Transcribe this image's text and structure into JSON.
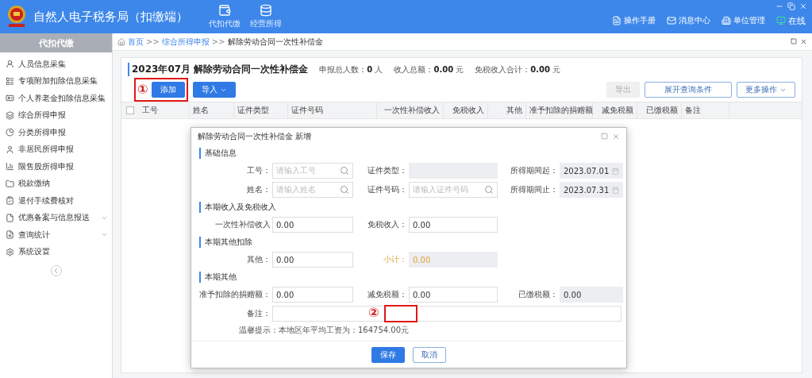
{
  "app": {
    "title": "自然人电子税务局（扣缴端）"
  },
  "modules": [
    {
      "label": "代扣代缴",
      "kind": "wallet"
    },
    {
      "label": "经营所得",
      "kind": "database"
    }
  ],
  "header_links": [
    {
      "label": "操作手册",
      "kind": "manual"
    },
    {
      "label": "消息中心",
      "kind": "mail"
    },
    {
      "label": "单位管理",
      "kind": "building"
    },
    {
      "label": "在线",
      "kind": "online"
    }
  ],
  "sidebar": {
    "title": "代扣代缴",
    "items": [
      {
        "label": "人员信息采集",
        "kind": "person",
        "expandable": false
      },
      {
        "label": "专项附加扣除信息采集",
        "kind": "list",
        "expandable": false
      },
      {
        "label": "个人养老金扣除信息采集",
        "kind": "card",
        "expandable": false
      },
      {
        "label": "综合所得申报",
        "kind": "layers",
        "expandable": false
      },
      {
        "label": "分类所得申报",
        "kind": "pie",
        "expandable": false
      },
      {
        "label": "非居民所得申报",
        "kind": "user",
        "expandable": false
      },
      {
        "label": "限售股所得申报",
        "kind": "bars",
        "expandable": false
      },
      {
        "label": "税款缴纳",
        "kind": "folder",
        "expandable": false
      },
      {
        "label": "退付手续费核对",
        "kind": "check",
        "expandable": false
      },
      {
        "label": "优惠备案与信息报送",
        "kind": "file",
        "expandable": true
      },
      {
        "label": "查询统计",
        "kind": "search",
        "expandable": true
      },
      {
        "label": "系统设置",
        "kind": "settings",
        "expandable": false
      }
    ]
  },
  "breadcrumb": {
    "separator": ">>",
    "items": [
      "首页",
      "综合所得申报",
      "解除劳动合同一次性补偿金"
    ]
  },
  "page": {
    "title": "2023年07月 解除劳动合同一次性补偿金",
    "summary": [
      {
        "label": "申报总人数：",
        "value": "0",
        "unit": "人"
      },
      {
        "label": "收入总额：",
        "value": "0.00",
        "unit": "元"
      },
      {
        "label": "免税收入合计：",
        "value": "0.00",
        "unit": "元"
      }
    ],
    "left_buttons": [
      {
        "label": "添加",
        "kind": "primary",
        "marker": "①"
      },
      {
        "label": "导入",
        "kind": "primary_dropdown"
      }
    ],
    "right_buttons": [
      {
        "label": "导出",
        "kind": "plain",
        "disabled": true
      },
      {
        "label": "展开查询条件",
        "kind": "outline",
        "disabled": false
      },
      {
        "label": "更多操作",
        "kind": "dropdown",
        "disabled": false
      }
    ]
  },
  "table": {
    "select_all_checked": false,
    "columns": [
      "工号",
      "姓名",
      "证件类型",
      "证件号码",
      "一次性补偿收入",
      "免税收入",
      "其他",
      "准予扣除的捐赠额",
      "减免税额",
      "已缴税额",
      "备注"
    ]
  },
  "dialog": {
    "title": "解除劳动合同一次性补偿金 新增",
    "sections": [
      {
        "title": "基础信息",
        "rows": [
          [
            {
              "label": "工号：",
              "placeholder": "请输入工号",
              "kind": "search"
            },
            {
              "label": "证件类型：",
              "kind": "readonly"
            },
            {
              "label": "所得期间起：",
              "value": "2023.07.01",
              "kind": "date"
            }
          ],
          [
            {
              "label": "姓名：",
              "placeholder": "请输入姓名",
              "kind": "search"
            },
            {
              "label": "证件号码：",
              "placeholder": "请输入证件号码",
              "kind": "search"
            },
            {
              "label": "所得期间止：",
              "value": "2023.07.31",
              "kind": "date"
            }
          ]
        ]
      },
      {
        "title": "本期收入及免税收入",
        "rows": [
          [
            {
              "label": "一次性补偿收入",
              "value": "0.00",
              "kind": "text"
            },
            {
              "label": "免税收入：",
              "value": "0.00",
              "kind": "text"
            }
          ]
        ]
      },
      {
        "title": "本期其他扣除",
        "rows": [
          [
            {
              "label": "其他：",
              "value": "0.00",
              "kind": "text"
            },
            {
              "label": "小计：",
              "value": "0.00",
              "kind": "subtotal"
            }
          ]
        ]
      },
      {
        "title": "本期其他",
        "rows": [
          [
            {
              "label": "准予扣除的捐赠额：",
              "value": "0.00",
              "kind": "text"
            },
            {
              "label": "减免税额：",
              "value": "0.00",
              "kind": "text"
            },
            {
              "label": "已缴税额：",
              "value": "0.00",
              "kind": "readonly"
            }
          ],
          [
            {
              "label": "备注：",
              "kind": "wide",
              "marker": "②"
            }
          ]
        ]
      }
    ],
    "hint": "温馨提示：本地区年平均工资为：164754.00元",
    "buttons": [
      {
        "label": "保存",
        "kind": "primary"
      },
      {
        "label": "取消",
        "kind": "plain"
      }
    ]
  }
}
